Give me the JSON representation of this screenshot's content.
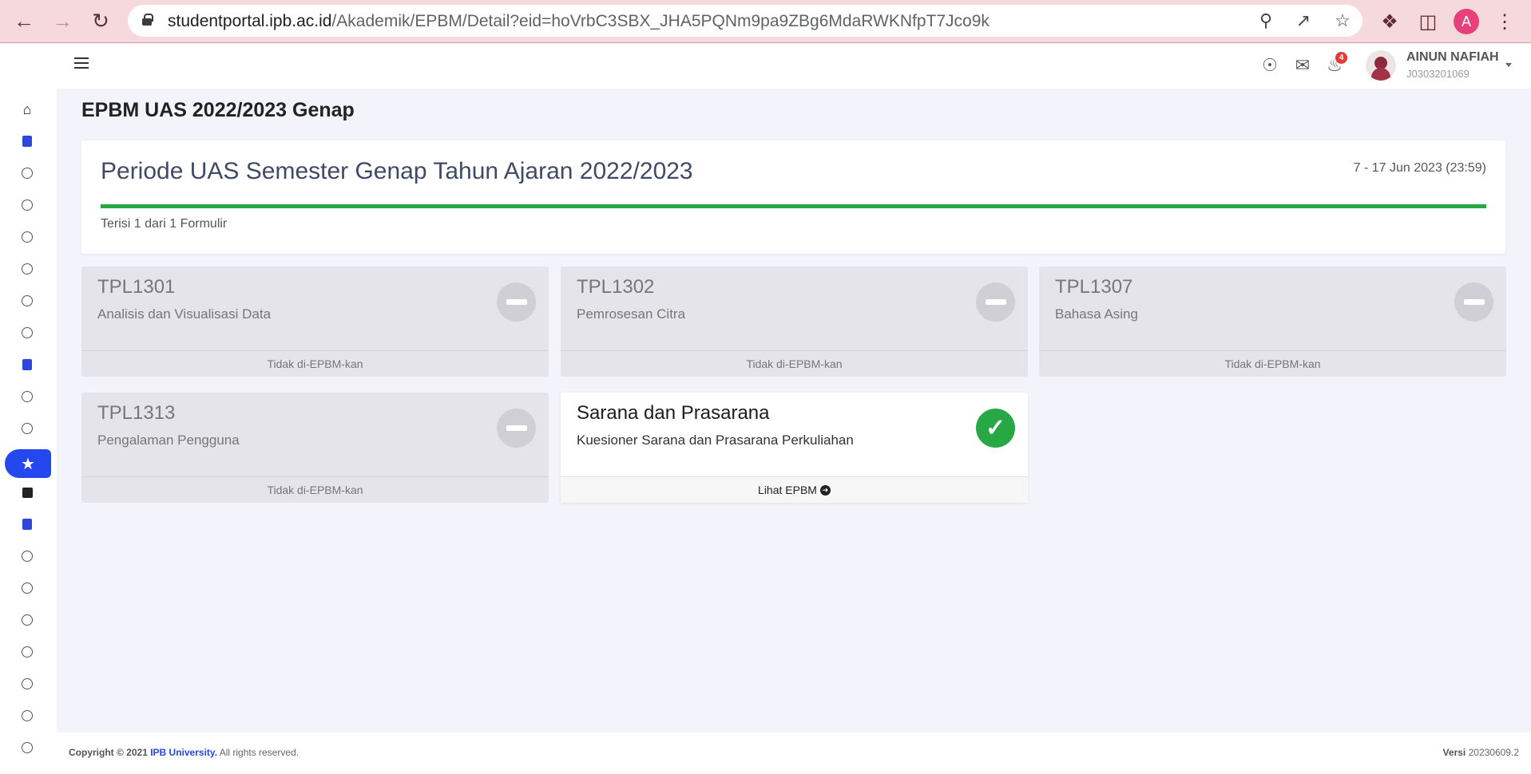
{
  "browser": {
    "url_host": "studentportal.ipb.ac.id",
    "url_path": "/Akademik/EPBM/Detail?eid=hoVrbC3SBX_JHA5PQNm9pa9ZBg6MdaRWKNfpT7Jco9k",
    "profile_initial": "A"
  },
  "header": {
    "notification_count": "4",
    "user_name": "AINUN NAFIAH",
    "user_id": "J0303201069"
  },
  "page": {
    "title": "EPBM UAS 2022/2023 Genap"
  },
  "period": {
    "title": "Periode UAS Semester Genap Tahun Ajaran 2022/2023",
    "date_range": "7 - 17 Jun 2023 (23:59)",
    "progress_text": "Terisi 1 dari 1 Formulir",
    "progress_fraction": 1.0
  },
  "courses": [
    {
      "code": "TPL1301",
      "name": "Analisis dan Visualisasi Data",
      "footer": "Tidak di-EPBM-kan",
      "status": "not-evaluated"
    },
    {
      "code": "TPL1302",
      "name": "Pemrosesan Citra",
      "footer": "Tidak di-EPBM-kan",
      "status": "not-evaluated"
    },
    {
      "code": "TPL1307",
      "name": "Bahasa Asing",
      "footer": "Tidak di-EPBM-kan",
      "status": "not-evaluated"
    },
    {
      "code": "TPL1313",
      "name": "Pengalaman Pengguna",
      "footer": "Tidak di-EPBM-kan",
      "status": "not-evaluated"
    },
    {
      "code": "Sarana dan Prasarana",
      "name": "Kuesioner Sarana dan Prasarana Perkuliahan",
      "footer": "Lihat EPBM",
      "status": "completed"
    }
  ],
  "footer": {
    "copyright_prefix": "Copyright © 2021",
    "brand": "IPB University.",
    "copyright_suffix": "All rights reserved.",
    "version_label": "Versi",
    "version_value": "20230609.2"
  },
  "colors": {
    "accent": "#2447ee",
    "success": "#27a844",
    "browser_bar": "#f5d9dc"
  },
  "icons": {
    "sidebar": [
      "home-icon",
      "book-icon",
      "circle-icon",
      "clipboard-icon",
      "star-icon",
      "note-icon",
      "graduate-icon"
    ],
    "topbar": [
      "compass-icon",
      "chat-icon",
      "bell-icon"
    ]
  }
}
